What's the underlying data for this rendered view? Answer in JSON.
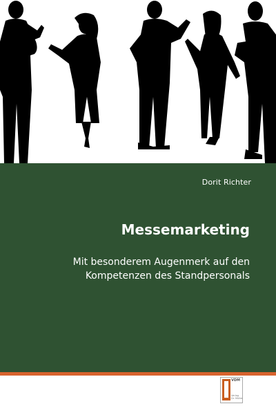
{
  "book": {
    "author": "Dorit Richter",
    "title": "Messemarketing",
    "subtitle": "Mit besonderem Augenmerk auf den Kompetenzen des Standpersonals"
  },
  "publisher": {
    "logo_name": "VDM",
    "logo_sub_line1": "Verlag",
    "logo_sub_line2": "Dr. Müller"
  },
  "colors": {
    "panel": "#2f5232",
    "accent_rule": "#d8632e",
    "logo_mark": "#c95e20",
    "silhouettes": "#000000"
  }
}
